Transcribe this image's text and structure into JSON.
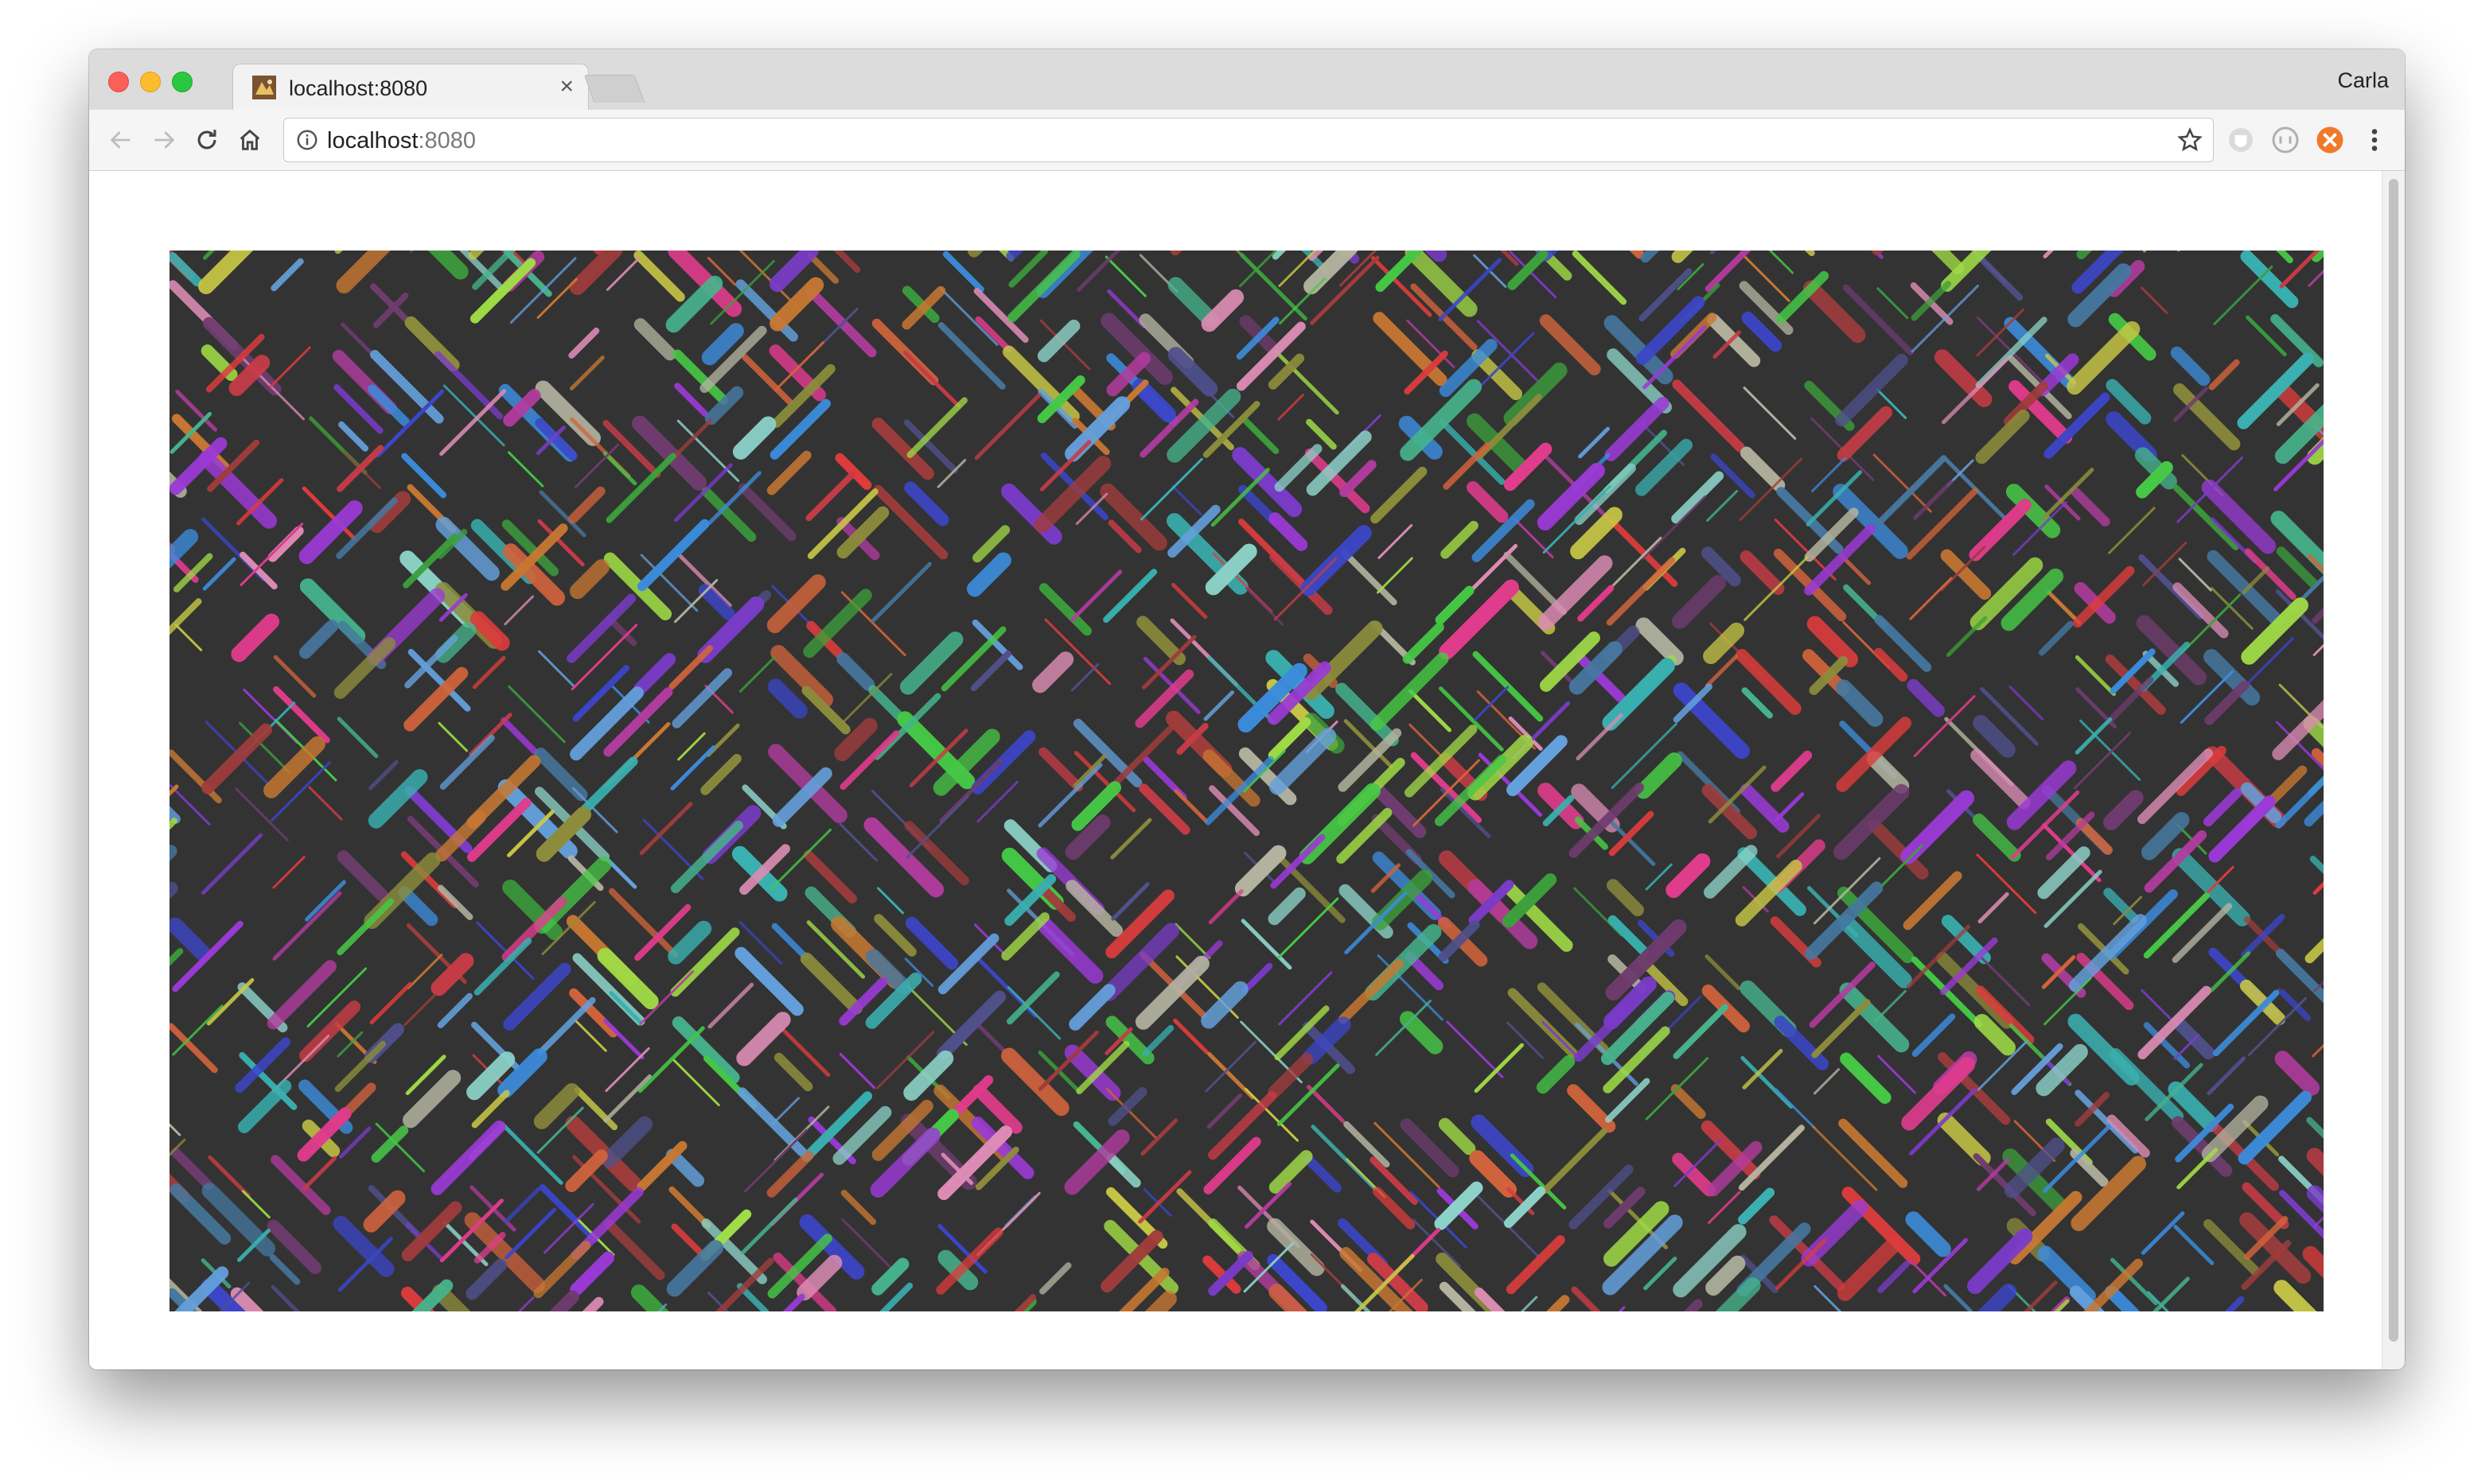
{
  "browser": {
    "tab": {
      "title": "localhost:8080",
      "close_glyph": "×"
    },
    "profile_name": "Carla",
    "omnibox": {
      "host": "localhost",
      "port": ":8080"
    }
  },
  "artwork": {
    "description": "Generative maze of colored diagonal rounded line segments on dark background",
    "background_color": "#333333",
    "palette": [
      "#3ab0b0",
      "#9b3ad6",
      "#c8c846",
      "#e03c8c",
      "#3c8cdc",
      "#46c846",
      "#d2643c",
      "#7a3cc8",
      "#b4b4a0",
      "#3c46c8",
      "#c83c46",
      "#46b48c",
      "#8c8c3c",
      "#dc8cb4",
      "#64a0dc",
      "#b43ca0",
      "#a0dc46",
      "#dc3c3c",
      "#50508c",
      "#8cd2c8",
      "#c87832",
      "#6e3c6e",
      "#3ca03c",
      "#a03c3c",
      "#4678a0"
    ]
  }
}
